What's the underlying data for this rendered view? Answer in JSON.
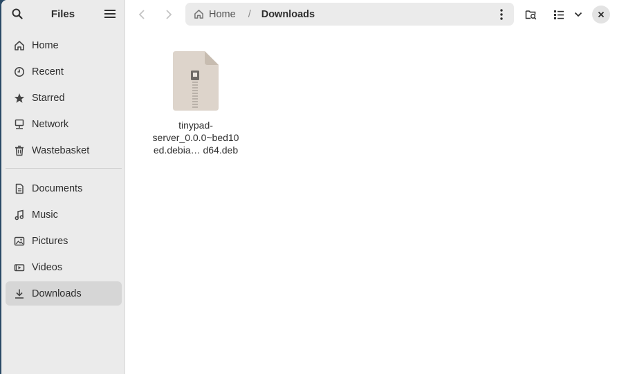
{
  "app": {
    "title": "Files"
  },
  "sidebar": {
    "places": [
      {
        "label": "Home",
        "icon": "home-icon"
      },
      {
        "label": "Recent",
        "icon": "clock-icon"
      },
      {
        "label": "Starred",
        "icon": "star-icon"
      },
      {
        "label": "Network",
        "icon": "network-icon"
      },
      {
        "label": "Wastebasket",
        "icon": "trash-icon"
      }
    ],
    "bookmarks": [
      {
        "label": "Documents",
        "icon": "document-icon"
      },
      {
        "label": "Music",
        "icon": "music-icon"
      },
      {
        "label": "Pictures",
        "icon": "picture-icon"
      },
      {
        "label": "Videos",
        "icon": "video-icon"
      },
      {
        "label": "Downloads",
        "icon": "download-icon",
        "active": true
      }
    ]
  },
  "pathbar": {
    "home_label": "Home",
    "separator": "/",
    "current": "Downloads"
  },
  "files": [
    {
      "name_lines": [
        "tinypad-",
        "server_0.0.0~bed10",
        "ed.debia…  d64.deb"
      ],
      "type": "archive"
    }
  ],
  "colors": {
    "sidebar_bg": "#ebebeb",
    "active_item_bg": "#d6d6d6",
    "desktop_bg": "#2a4a66",
    "file_icon": "#ddd4cb"
  }
}
